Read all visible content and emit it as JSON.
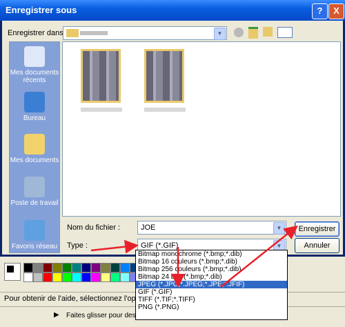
{
  "dialog": {
    "title": "Enregistrer sous",
    "help_button": "?",
    "close_button": "X",
    "save_in_label": "Enregistrer dans :",
    "places": [
      {
        "label": "Mes documents récents"
      },
      {
        "label": "Bureau"
      },
      {
        "label": "Mes documents"
      },
      {
        "label": "Poste de travail"
      },
      {
        "label": "Favoris réseau"
      }
    ],
    "filename_label": "Nom du fichier :",
    "filename_value": "JOE",
    "type_label": "Type :",
    "type_value": "GIF (*.GIF)",
    "save_button": "Enregistrer",
    "cancel_button": "Annuler",
    "type_options": [
      "Bitmap monochrome (*.bmp;*.dib)",
      "Bitmap 16 couleurs (*.bmp;*.dib)",
      "Bitmap 256 couleurs (*.bmp;*.dib)",
      "Bitmap 24 bits (*.bmp;*.dib)",
      "JPEG (*.JPG;*.JPEG;*.JPE;*.JFIF)",
      "GIF (*.GIF)",
      "TIFF (*.TIF;*.TIFF)",
      "PNG (*.PNG)"
    ],
    "selected_option": "JPEG (*.JPG;*.JPEG;*.JPE;*.JFIF)"
  },
  "status_bar": {
    "help_text": "Pour obtenir de l'aide, sélectionnez l'option R",
    "hint_text": "Faites glisser pour dessin"
  },
  "colors": {
    "title_bar": "#0a5fe0",
    "places_bar": "#84a0d8",
    "selection": "#316ac5",
    "annotation_arrow": "#e8202a"
  }
}
